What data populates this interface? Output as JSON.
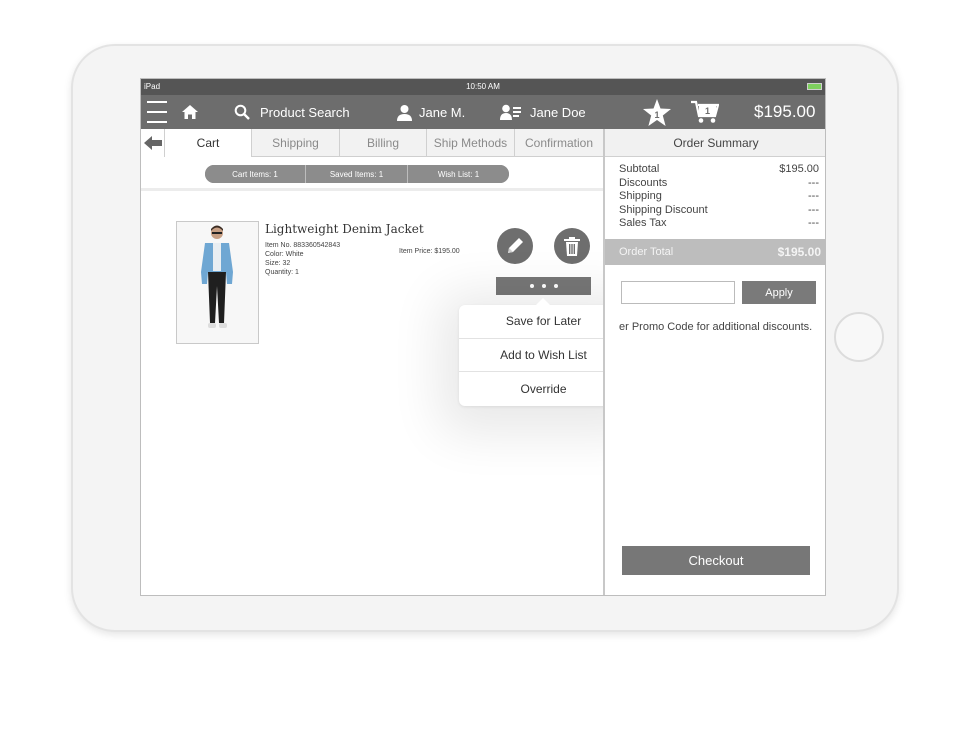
{
  "status_bar": {
    "device": "iPad",
    "time": "10:50 AM"
  },
  "toolbar": {
    "search_label": "Product Search",
    "user_label": "Jane M.",
    "customer_label": "Jane Doe",
    "favorites_badge": "1",
    "cart_badge": "1",
    "cart_total": "$195.00"
  },
  "tabs": [
    "Cart",
    "Shipping",
    "Billing",
    "Ship Methods",
    "Confirmation"
  ],
  "cart_pills": {
    "cart_items": "Cart Items: 1",
    "saved_items": "Saved Items: 1",
    "wish_list": "Wish List: 1"
  },
  "item": {
    "title": "Lightweight Denim Jacket",
    "item_no": "Item No. 883360542843",
    "color": "Color: White",
    "size": "Size: 32",
    "quantity": "Quantity: 1",
    "price": "Item Price: $195.00"
  },
  "popup_menu": [
    "Save for Later",
    "Add to Wish List",
    "Override"
  ],
  "order_summary": {
    "title": "Order Summary",
    "rows": [
      {
        "label": "Subtotal",
        "value": "$195.00"
      },
      {
        "label": "Discounts",
        "value": "---"
      },
      {
        "label": "Shipping",
        "value": "---"
      },
      {
        "label": "Shipping Discount",
        "value": "---"
      },
      {
        "label": "Sales Tax",
        "value": "---"
      }
    ],
    "total_label": "Order Total",
    "total_value": "$195.00",
    "apply_label": "Apply",
    "promo_text": "er Promo Code for additional discounts.",
    "checkout_label": "Checkout"
  },
  "colors": {
    "toolbar": "#6d6d6d",
    "button": "#777777",
    "battery": "#7ed05e"
  },
  "icons": [
    "menu-icon",
    "home-icon",
    "search-icon",
    "user-icon",
    "customer-list-icon",
    "star-icon",
    "cart-icon",
    "back-arrow-icon",
    "pencil-icon",
    "trash-icon",
    "more-dots-icon"
  ]
}
